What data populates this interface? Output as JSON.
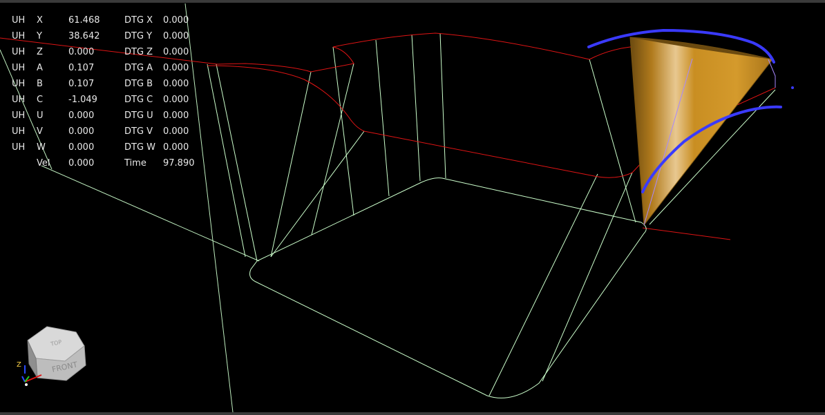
{
  "dro": {
    "rows": [
      {
        "unit": "UH",
        "axis": "X",
        "value": "61.468",
        "dtg_label": "DTG X",
        "dtg_value": "0.000"
      },
      {
        "unit": "UH",
        "axis": "Y",
        "value": "38.642",
        "dtg_label": "DTG Y",
        "dtg_value": "0.000"
      },
      {
        "unit": "UH",
        "axis": "Z",
        "value": "0.000",
        "dtg_label": "DTG Z",
        "dtg_value": "0.000"
      },
      {
        "unit": "UH",
        "axis": "A",
        "value": "0.107",
        "dtg_label": "DTG A",
        "dtg_value": "0.000"
      },
      {
        "unit": "UH",
        "axis": "B",
        "value": "0.107",
        "dtg_label": "DTG B",
        "dtg_value": "0.000"
      },
      {
        "unit": "UH",
        "axis": "C",
        "value": "-1.049",
        "dtg_label": "DTG C",
        "dtg_value": "0.000"
      },
      {
        "unit": "UH",
        "axis": "U",
        "value": "0.000",
        "dtg_label": "DTG U",
        "dtg_value": "0.000"
      },
      {
        "unit": "UH",
        "axis": "V",
        "value": "0.000",
        "dtg_label": "DTG V",
        "dtg_value": "0.000"
      },
      {
        "unit": "UH",
        "axis": "W",
        "value": "0.000",
        "dtg_label": "DTG W",
        "dtg_value": "0.000"
      }
    ],
    "vel_label": "Vel",
    "vel_value": "0.000",
    "time_label": "Time",
    "time_value": "97.890"
  },
  "viewcube": {
    "top_label": "TOP",
    "front_label": "FRONT",
    "axis_label": "Z"
  },
  "colors": {
    "background": "#000000",
    "toolpath_feed": "#ccffcc",
    "toolpath_rapid": "#e01414",
    "tool_cone": "#d4931e",
    "annotation": "#3a3aff",
    "dro_text": "#eaeaea"
  },
  "icons": {
    "tool": "cone-tool-icon",
    "orientation": "view-cube-icon"
  }
}
